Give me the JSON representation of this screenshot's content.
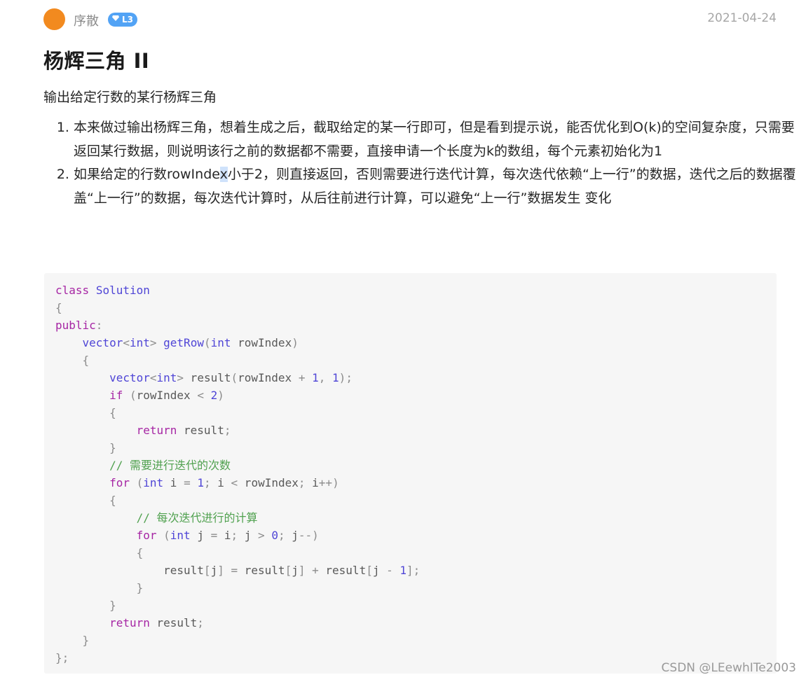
{
  "header": {
    "author": "序散",
    "badge": "L3",
    "date": "2021-04-24"
  },
  "article": {
    "title": "杨辉三角 II",
    "intro": "输出给定行数的某行杨辉三角",
    "steps": [
      {
        "text": "本来做过输出杨辉三角，想着生成之后，截取给定的某一行即可，但是看到提示说，能否优化到O(k)的空间复杂度，只需要返回某行数据，则说明该行之前的数据都不需要，直接申请一个长度为k的数组，每个元素初始化为1"
      },
      {
        "before": "如果给定的行数rowInde",
        "selected": "x",
        "after": "小于2，则直接返回，否则需要进行迭代计算，每次迭代依赖“上一行”的数据，迭代之后的数据覆盖“上一行”的数据，每次迭代计算时，从后往前进行计算，可以避免“上一行”数据发生 变化"
      }
    ]
  },
  "code": {
    "language": "cpp",
    "lines": [
      "class Solution",
      "{",
      "public:",
      "    vector<int> getRow(int rowIndex)",
      "    {",
      "        vector<int> result(rowIndex + 1, 1);",
      "        if (rowIndex < 2)",
      "        {",
      "            return result;",
      "        }",
      "        // 需要进行迭代的次数",
      "        for (int i = 1; i < rowIndex; i++)",
      "        {",
      "            // 每次迭代进行的计算",
      "            for (int j = i; j > 0; j--)",
      "            {",
      "                result[j] = result[j] + result[j - 1];",
      "            }",
      "        }",
      "        return result;",
      "    }",
      "};"
    ]
  },
  "watermark": "CSDN @LEewhITe2003",
  "colors": {
    "avatar": "#f28a1f",
    "badge": "#52a3f5",
    "keyword": "#a626a4",
    "function": "#4f45d6",
    "comment": "#50a14f"
  },
  "icons": {
    "badge": "diamond-icon"
  }
}
